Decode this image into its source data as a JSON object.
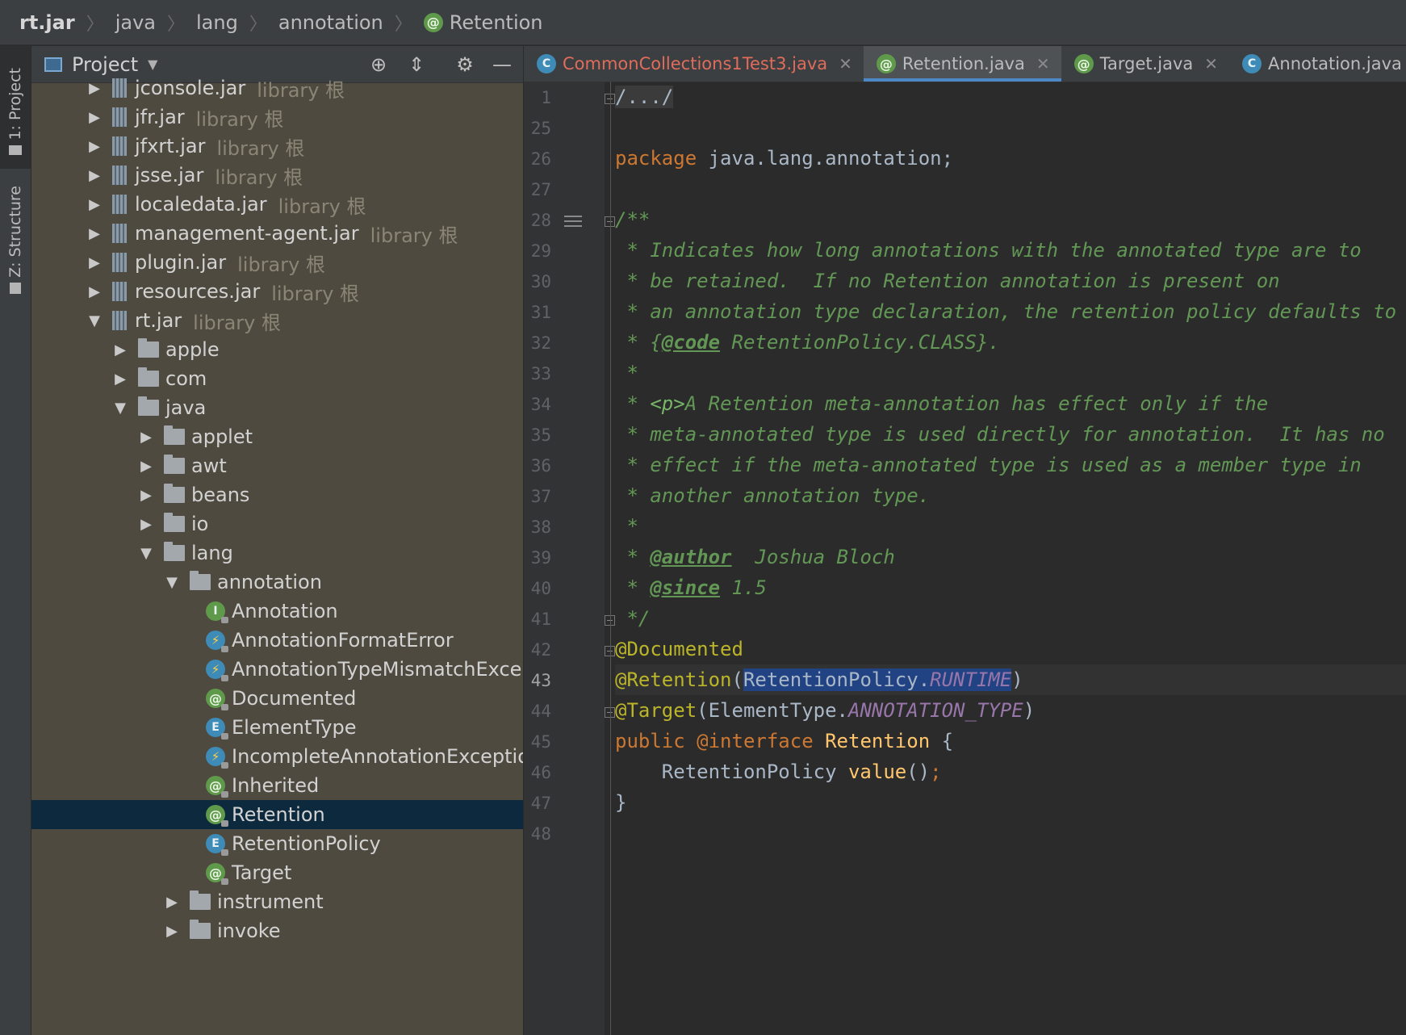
{
  "breadcrumb": {
    "items": [
      "rt.jar",
      "java",
      "lang",
      "annotation"
    ],
    "current": "Retention",
    "current_icon": "annotation-icon"
  },
  "tool_strip": {
    "project_tab": "1: Project",
    "structure_tab": "Z: Structure"
  },
  "project_panel": {
    "title": "Project",
    "buttons": [
      "locate-icon",
      "collapse-all-icon",
      "gear-icon",
      "minimize-icon"
    ],
    "tree": [
      {
        "label": "jconsole.jar",
        "tag": "library 根",
        "type": "jar",
        "depth": 0,
        "expanded": false
      },
      {
        "label": "jfr.jar",
        "tag": "library 根",
        "type": "jar",
        "depth": 0,
        "expanded": false
      },
      {
        "label": "jfxrt.jar",
        "tag": "library 根",
        "type": "jar",
        "depth": 0,
        "expanded": false
      },
      {
        "label": "jsse.jar",
        "tag": "library 根",
        "type": "jar",
        "depth": 0,
        "expanded": false
      },
      {
        "label": "localedata.jar",
        "tag": "library 根",
        "type": "jar",
        "depth": 0,
        "expanded": false
      },
      {
        "label": "management-agent.jar",
        "tag": "library 根",
        "type": "jar",
        "depth": 0,
        "expanded": false
      },
      {
        "label": "plugin.jar",
        "tag": "library 根",
        "type": "jar",
        "depth": 0,
        "expanded": false
      },
      {
        "label": "resources.jar",
        "tag": "library 根",
        "type": "jar",
        "depth": 0,
        "expanded": false
      },
      {
        "label": "rt.jar",
        "tag": "library 根",
        "type": "jar",
        "depth": 0,
        "expanded": true
      },
      {
        "label": "apple",
        "type": "folder",
        "depth": 1,
        "expanded": false
      },
      {
        "label": "com",
        "type": "folder",
        "depth": 1,
        "expanded": false
      },
      {
        "label": "java",
        "type": "folder",
        "depth": 1,
        "expanded": true
      },
      {
        "label": "applet",
        "type": "folder",
        "depth": 2,
        "expanded": false
      },
      {
        "label": "awt",
        "type": "folder",
        "depth": 2,
        "expanded": false
      },
      {
        "label": "beans",
        "type": "folder",
        "depth": 2,
        "expanded": false
      },
      {
        "label": "io",
        "type": "folder",
        "depth": 2,
        "expanded": false
      },
      {
        "label": "lang",
        "type": "folder",
        "depth": 2,
        "expanded": true
      },
      {
        "label": "annotation",
        "type": "folder",
        "depth": 3,
        "expanded": true
      },
      {
        "label": "Annotation",
        "type": "interface",
        "depth": 4
      },
      {
        "label": "AnnotationFormatError",
        "type": "exception",
        "depth": 4
      },
      {
        "label": "AnnotationTypeMismatchException",
        "type": "exception",
        "depth": 4
      },
      {
        "label": "Documented",
        "type": "annotation",
        "depth": 4
      },
      {
        "label": "ElementType",
        "type": "enum",
        "depth": 4
      },
      {
        "label": "IncompleteAnnotationException",
        "type": "exception",
        "depth": 4
      },
      {
        "label": "Inherited",
        "type": "annotation",
        "depth": 4
      },
      {
        "label": "Retention",
        "type": "annotation",
        "depth": 4,
        "selected": true
      },
      {
        "label": "RetentionPolicy",
        "type": "enum",
        "depth": 4
      },
      {
        "label": "Target",
        "type": "annotation",
        "depth": 4
      },
      {
        "label": "instrument",
        "type": "folder",
        "depth": 3,
        "expanded": false
      },
      {
        "label": "invoke",
        "type": "folder",
        "depth": 3,
        "expanded": false
      }
    ]
  },
  "editor": {
    "tabs": [
      {
        "label": "CommonCollections1Test3.java",
        "icon": "class-icon",
        "modified": true,
        "active": false
      },
      {
        "label": "Retention.java",
        "icon": "annotation-icon",
        "modified": false,
        "active": true
      },
      {
        "label": "Target.java",
        "icon": "annotation-icon",
        "modified": false,
        "active": false
      },
      {
        "label": "Annotation.java",
        "icon": "class-icon",
        "modified": false,
        "active": false
      }
    ],
    "line_numbers": [
      "1",
      "25",
      "26",
      "27",
      "28",
      "29",
      "30",
      "31",
      "32",
      "33",
      "34",
      "35",
      "36",
      "37",
      "38",
      "39",
      "40",
      "41",
      "42",
      "43",
      "44",
      "45",
      "46",
      "47",
      "48"
    ],
    "current_line": "43",
    "code": {
      "l1": "/.../",
      "l26_kw": "package",
      "l26_rest": " java.lang.annotation;",
      "l28": "/**",
      "l29": " * Indicates how long annotations with the annotated type are to",
      "l30": " * be retained.  If no Retention annotation is present on",
      "l31": " * an annotation type declaration, the retention policy defaults to",
      "l32_a": " * {",
      "l32_tag": "@code",
      "l32_b": " RetentionPolicy.CLASS}.",
      "l33": " *",
      "l34_a": " * ",
      "l34_tag": "<p>",
      "l34_b": "A Retention meta-annotation has effect only if the",
      "l35": " * meta-annotated type is used directly for annotation.  It has no",
      "l36": " * effect if the meta-annotated type is used as a member type in",
      "l37": " * another annotation type.",
      "l38": " *",
      "l39_a": " * ",
      "l39_tag": "@author",
      "l39_b": "  Joshua Bloch",
      "l40_a": " * ",
      "l40_tag": "@since",
      "l40_b": " 1.5",
      "l41": " */",
      "l42": "@Documented",
      "l43_ann": "@Retention",
      "l43_open": "(",
      "l43_cls": "RetentionPolicy.",
      "l43_const": "RUNTIME",
      "l43_close": ")",
      "l44_ann": "@Target",
      "l44_open": "(ElementType.",
      "l44_const": "ANNOTATION_TYPE",
      "l44_close": ")",
      "l45_kw": "public",
      "l45_ann": " @interface",
      "l45_name": " Retention",
      "l45_rest": " {",
      "l46_type": "    RetentionPolicy ",
      "l46_fn": "value",
      "l46_paren": "()",
      "l46_semi": ";",
      "l47": "}"
    }
  }
}
